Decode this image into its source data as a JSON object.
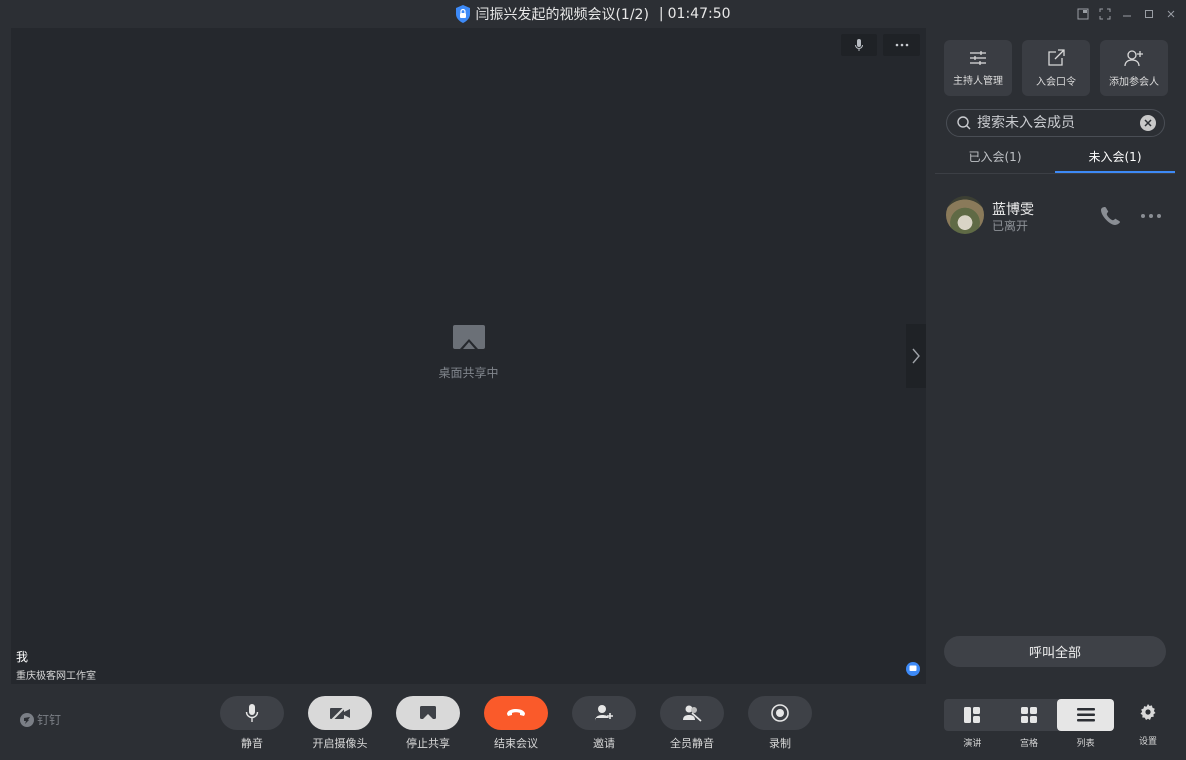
{
  "title": {
    "meeting": "闫振兴发起的视频会议(1/2)",
    "separator": "|",
    "timer": "01:47:50"
  },
  "stage": {
    "share_status": "桌面共享中",
    "self_name": "我",
    "self_org": "重庆极客网工作室"
  },
  "panel": {
    "actions": [
      {
        "label": "主持人管理",
        "icon": "sliders-icon"
      },
      {
        "label": "入会口令",
        "icon": "share-out-icon"
      },
      {
        "label": "添加参会人",
        "icon": "add-person-icon"
      }
    ],
    "search_placeholder": "搜索未入会成员",
    "tabs": [
      {
        "label": "已入会(1)",
        "active": false
      },
      {
        "label": "未入会(1)",
        "active": true
      }
    ],
    "members": [
      {
        "name": "蓝博雯",
        "status": "已离开"
      }
    ],
    "call_all": "呼叫全部"
  },
  "toolbar": {
    "brand": "钉钉",
    "controls": [
      {
        "label": "静音",
        "icon": "mic-icon"
      },
      {
        "label": "开启摄像头",
        "icon": "camera-off-icon"
      },
      {
        "label": "停止共享",
        "icon": "share-screen-icon"
      },
      {
        "label": "结束会议",
        "icon": "hangup-icon"
      },
      {
        "label": "邀请",
        "icon": "invite-icon"
      },
      {
        "label": "全员静音",
        "icon": "mute-all-icon"
      },
      {
        "label": "录制",
        "icon": "record-icon"
      }
    ],
    "views": [
      {
        "label": "演讲",
        "active": false
      },
      {
        "label": "宫格",
        "active": false
      },
      {
        "label": "列表",
        "active": true
      }
    ],
    "settings": "设置"
  },
  "colors": {
    "accent": "#3d8af7",
    "hangup": "#fa5a2a",
    "background": "#2c2f34",
    "stage": "#25282d"
  }
}
